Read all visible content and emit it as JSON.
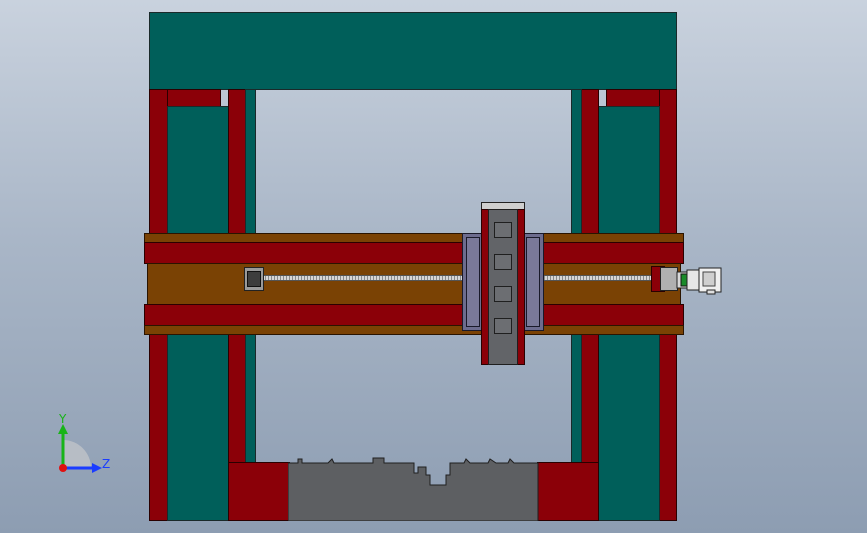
{
  "viewport": {
    "background": "#a9b6c7",
    "colors": {
      "frame": "#005f5a",
      "column_liner": "#8b0008",
      "beam": "#7a4204",
      "carriage": "#6d6c8e",
      "ram": "#8b0008",
      "base": "#5d5f62",
      "lead_screw": "#c8c8c8"
    }
  },
  "model": {
    "parts": [
      "top-crossbeam",
      "left-column",
      "right-column",
      "horizontal-beam",
      "lead-screw",
      "carriage",
      "ram",
      "motor",
      "base-die"
    ]
  },
  "triad": {
    "y_label": "Y",
    "z_label": "Z",
    "y_color": "#18b418",
    "z_color": "#1a3cff",
    "x_color": "#e01010"
  }
}
